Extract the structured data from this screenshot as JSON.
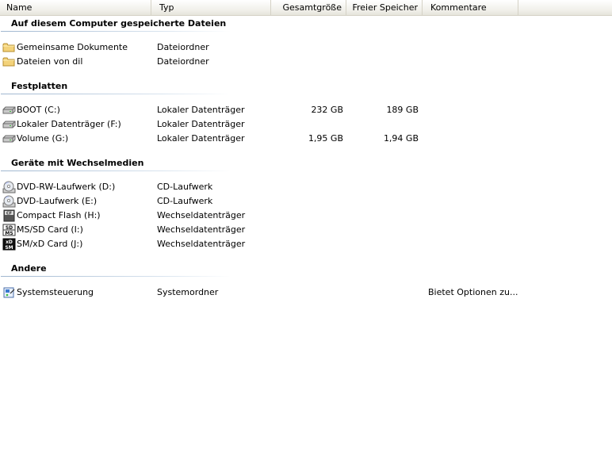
{
  "columns": {
    "name": "Name",
    "type": "Typ",
    "total_size": "Gesamtgröße",
    "free_space": "Freier Speicher",
    "comments": "Kommentare"
  },
  "groups": [
    {
      "title": "Auf diesem Computer gespeicherte Dateien",
      "items": [
        {
          "name": "Gemeinsame Dokumente",
          "type": "Dateiordner",
          "size": "",
          "free": "",
          "comment": "",
          "icon": "folder-icon"
        },
        {
          "name": "Dateien von dil",
          "type": "Dateiordner",
          "size": "",
          "free": "",
          "comment": "",
          "icon": "folder-icon"
        }
      ]
    },
    {
      "title": "Festplatten",
      "items": [
        {
          "name": "BOOT (C:)",
          "type": "Lokaler Datenträger",
          "size": "232 GB",
          "free": "189 GB",
          "comment": "",
          "icon": "hard-drive-icon"
        },
        {
          "name": "Lokaler Datenträger (F:)",
          "type": "Lokaler Datenträger",
          "size": "",
          "free": "",
          "comment": "",
          "icon": "hard-drive-icon"
        },
        {
          "name": "Volume (G:)",
          "type": "Lokaler Datenträger",
          "size": "1,95 GB",
          "free": "1,94 GB",
          "comment": "",
          "icon": "hard-drive-icon"
        }
      ]
    },
    {
      "title": "Geräte mit Wechselmedien",
      "items": [
        {
          "name": "DVD-RW-Laufwerk (D:)",
          "type": "CD-Laufwerk",
          "size": "",
          "free": "",
          "comment": "",
          "icon": "dvd-drive-icon"
        },
        {
          "name": "DVD-Laufwerk (E:)",
          "type": "CD-Laufwerk",
          "size": "",
          "free": "",
          "comment": "",
          "icon": "dvd-drive-icon"
        },
        {
          "name": "Compact Flash (H:)",
          "type": "Wechseldatenträger",
          "size": "",
          "free": "",
          "comment": "",
          "icon": "compact-flash-icon"
        },
        {
          "name": "MS/SD Card (I:)",
          "type": "Wechseldatenträger",
          "size": "",
          "free": "",
          "comment": "",
          "icon": "ms-sd-card-icon"
        },
        {
          "name": "SM/xD Card (J:)",
          "type": "Wechseldatenträger",
          "size": "",
          "free": "",
          "comment": "",
          "icon": "sm-xd-card-icon"
        }
      ]
    },
    {
      "title": "Andere",
      "items": [
        {
          "name": "Systemsteuerung",
          "type": "Systemordner",
          "size": "",
          "free": "",
          "comment": "Bietet Optionen zu...",
          "icon": "control-panel-icon"
        }
      ]
    }
  ],
  "icon_labels": {
    "ms_sd_top": "SD",
    "ms_sd_bottom": "MS",
    "sm_xd_top": "xD",
    "sm_xd_bottom": "SM",
    "compact_flash": "CF"
  },
  "colors": {
    "folder": "#f3d27a",
    "group_line": "#9fb6cf"
  }
}
